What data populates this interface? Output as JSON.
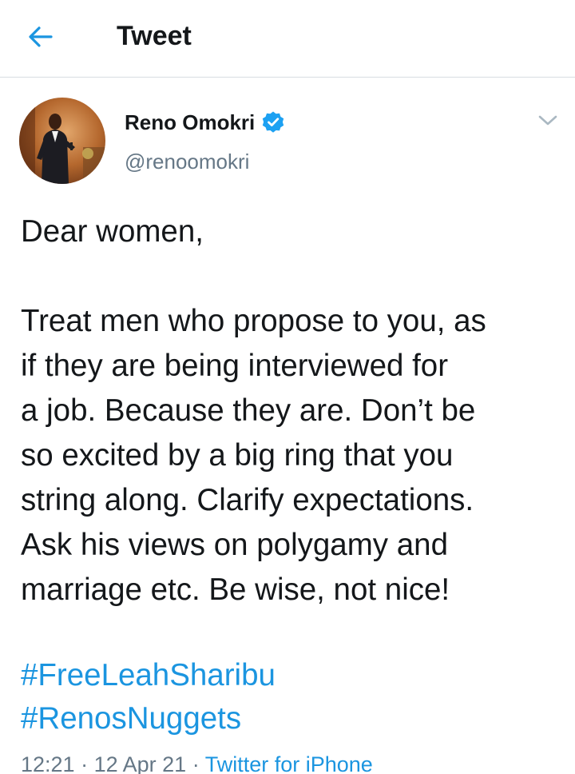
{
  "header": {
    "title": "Tweet",
    "back_icon": "arrow-left-icon"
  },
  "colors": {
    "accent": "#1b95e0",
    "text": "#14171a",
    "secondary_text": "#657786",
    "divider": "#d8dde2"
  },
  "tweet": {
    "author": {
      "name": "Reno Omokri",
      "handle": "@renoomokri",
      "verified": true,
      "avatar_icon": "profile-photo"
    },
    "menu_icon": "chevron-down-icon",
    "lines": [
      "Dear women,",
      "",
      "Treat men who propose to you, as",
      "if they are being interviewed for",
      "a job. Because they are. Don’t be",
      "so excited by a big ring that you",
      "string along. Clarify expectations.",
      "Ask his views on polygamy and",
      "marriage etc. Be wise, not nice!"
    ],
    "hashtags": [
      "#FreeLeahSharibu",
      "#RenosNuggets"
    ],
    "time": "12:21",
    "separator": "·",
    "date": "12 Apr 21",
    "source": "Twitter for iPhone"
  }
}
